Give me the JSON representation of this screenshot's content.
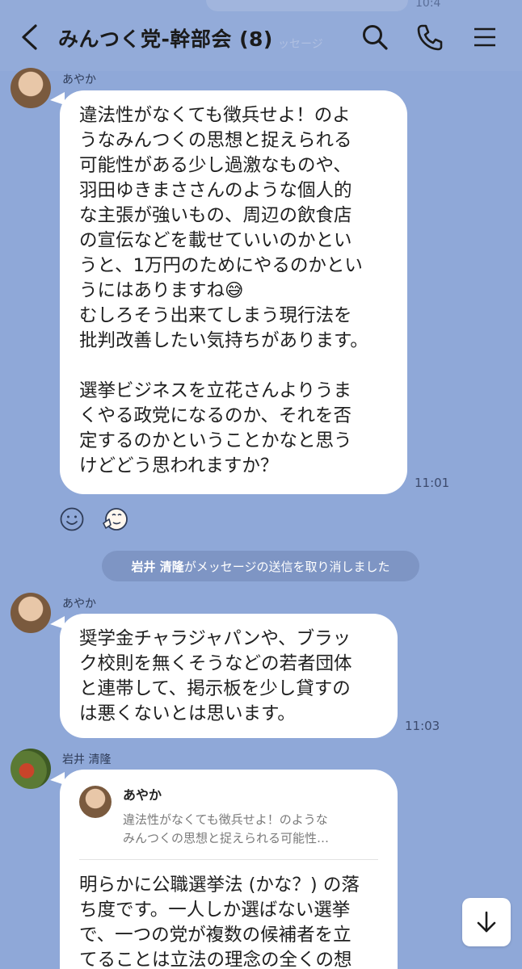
{
  "header": {
    "title": "みんつく党-幹部会 (8)",
    "prev_time": "10:4",
    "ghost_text": "ッセージ"
  },
  "messages": [
    {
      "sender": "あやか",
      "lines": [
        "違法性がなくても徴兵せよ！のよ",
        "うなみんつくの思想と捉えられる",
        "可能性がある少し過激なものや、",
        "羽田ゆきまささんのような個人的",
        "な主張が強いもの、周辺の飲食店",
        "の宣伝などを載せていいのかとい",
        "うと、1万円のためにやるのかとい",
        "うにはありますね😅",
        "むしろそう出来てしまう現行法を",
        "批判改善したい気持ちがあります。",
        "",
        "選挙ビジネスを立花さんよりうま",
        "くやる政党になるのか、それを否",
        "定するのかということかなと思う",
        "けどどう思われますか？"
      ],
      "time": "11:01"
    },
    {
      "sender": "あやか",
      "lines": [
        "奨学金チャラジャパンや、ブラッ",
        "ク校則を無くそうなどの若者団体",
        "と連帯して、掲示板を少し貸すの",
        "は悪くないとは思います。"
      ],
      "time": "11:03"
    },
    {
      "sender": "岩井 清隆",
      "reply": {
        "name": "あやか",
        "lines": [
          "違法性がなくても徴兵せよ！のような",
          "みんつくの思想と捉えられる可能性…"
        ]
      },
      "lines": [
        "明らかに公職選挙法 (かな？) の落",
        "ち度です。一人しか選ばない選挙",
        "で、一つの党が複数の候補者を立",
        "てることは立法の理念の全くの想"
      ]
    }
  ],
  "system": {
    "name": "岩井 清隆",
    "text": "がメッセージの送信を取り消しました"
  },
  "icons": {
    "back": "chevron-left-icon",
    "search": "search-icon",
    "call": "phone-icon",
    "menu": "menu-icon",
    "react_add": "smiley-add-icon",
    "react_sticker": "sticker-reaction-icon",
    "scroll_down": "arrow-down-icon"
  }
}
